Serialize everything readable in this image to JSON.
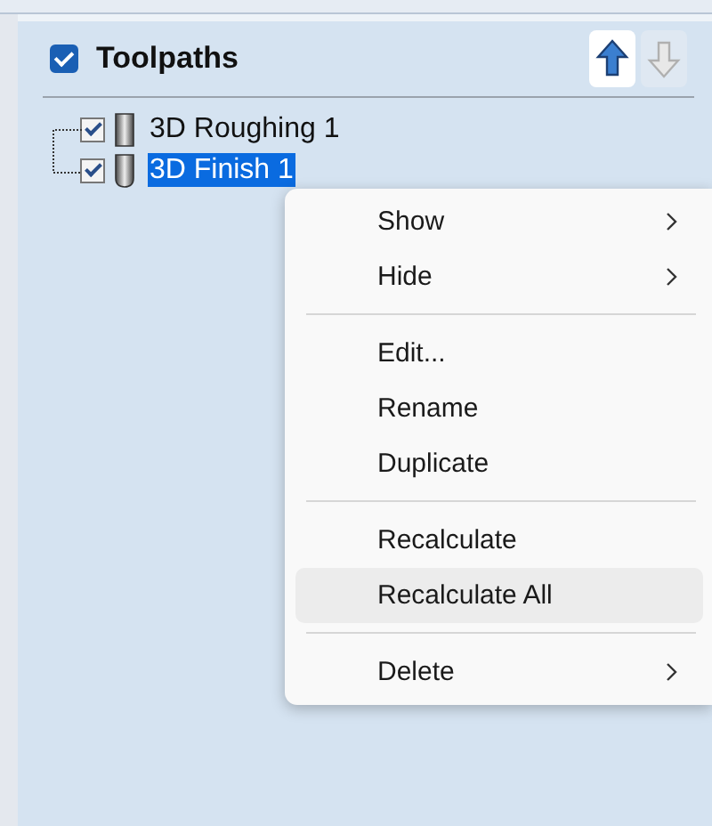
{
  "panel": {
    "title": "Toolpaths",
    "checked": true
  },
  "move_buttons": [
    {
      "kind": "up",
      "disabled": false
    },
    {
      "kind": "down",
      "disabled": true
    }
  ],
  "toolpaths": [
    {
      "label": "3D Roughing 1",
      "checked": true,
      "selected": false,
      "kind": "flat"
    },
    {
      "label": "3D Finish 1",
      "checked": true,
      "selected": true,
      "kind": "ball"
    }
  ],
  "context_menu": [
    {
      "kind": "item",
      "label": "Show",
      "submenu": true,
      "hovered": false
    },
    {
      "kind": "item",
      "label": "Hide",
      "submenu": true,
      "hovered": false
    },
    {
      "kind": "separator"
    },
    {
      "kind": "item",
      "label": "Edit...",
      "submenu": false,
      "hovered": false
    },
    {
      "kind": "item",
      "label": "Rename",
      "submenu": false,
      "hovered": false
    },
    {
      "kind": "item",
      "label": "Duplicate",
      "submenu": false,
      "hovered": false
    },
    {
      "kind": "separator"
    },
    {
      "kind": "item",
      "label": "Recalculate",
      "submenu": false,
      "hovered": false
    },
    {
      "kind": "item",
      "label": "Recalculate All",
      "submenu": false,
      "hovered": true
    },
    {
      "kind": "separator"
    },
    {
      "kind": "item",
      "label": "Delete",
      "submenu": true,
      "hovered": false
    }
  ]
}
